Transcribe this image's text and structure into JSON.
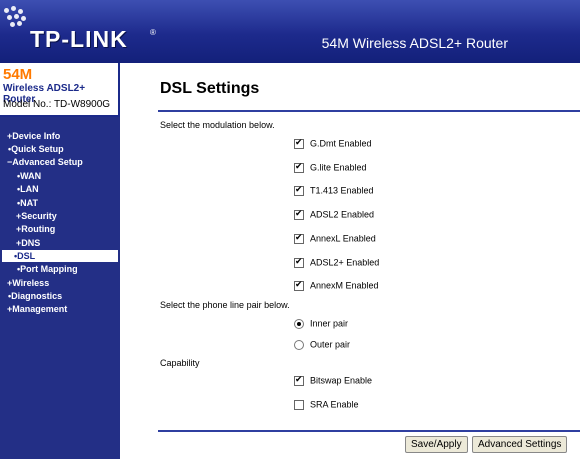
{
  "header": {
    "logo": "TP-LINK",
    "logo_mark": "®",
    "product": "54M Wireless ADSL2+ Router"
  },
  "model": {
    "speed": "54M",
    "name": "Wireless ADSL2+ Router",
    "number": "Model No.: TD-W8900G"
  },
  "sidebar": {
    "items": [
      {
        "label": "+Device Info"
      },
      {
        "label": "•Quick Setup"
      },
      {
        "label": "−Advanced Setup"
      },
      {
        "label": "•WAN"
      },
      {
        "label": "•LAN"
      },
      {
        "label": "•NAT"
      },
      {
        "label": "+Security"
      },
      {
        "label": "+Routing"
      },
      {
        "label": "+DNS"
      },
      {
        "label": "•DSL"
      },
      {
        "label": "•Port Mapping"
      },
      {
        "label": "+Wireless"
      },
      {
        "label": "•Diagnostics"
      },
      {
        "label": "+Management"
      }
    ]
  },
  "main": {
    "title": "DSL Settings",
    "modulation_prompt": "Select the modulation below.",
    "modulations": [
      {
        "label": "G.Dmt Enabled",
        "checked": true
      },
      {
        "label": "G.lite Enabled",
        "checked": true
      },
      {
        "label": "T1.413 Enabled",
        "checked": true
      },
      {
        "label": "ADSL2 Enabled",
        "checked": true
      },
      {
        "label": "AnnexL Enabled",
        "checked": true
      },
      {
        "label": "ADSL2+ Enabled",
        "checked": true
      },
      {
        "label": "AnnexM Enabled",
        "checked": true
      }
    ],
    "phone_line_prompt": "Select the phone line pair below.",
    "phone_line": [
      {
        "label": "Inner pair",
        "selected": true
      },
      {
        "label": "Outer pair",
        "selected": false
      }
    ],
    "capability_heading": "Capability",
    "capabilities": [
      {
        "label": "Bitswap Enable",
        "checked": true
      },
      {
        "label": "SRA Enable",
        "checked": false
      }
    ],
    "buttons": {
      "save": "Save/Apply",
      "advanced": "Advanced Settings"
    }
  },
  "colors": {
    "banner": "#1d2a8c",
    "sidebar": "#232f86",
    "accent_orange": "#ff7a00"
  }
}
